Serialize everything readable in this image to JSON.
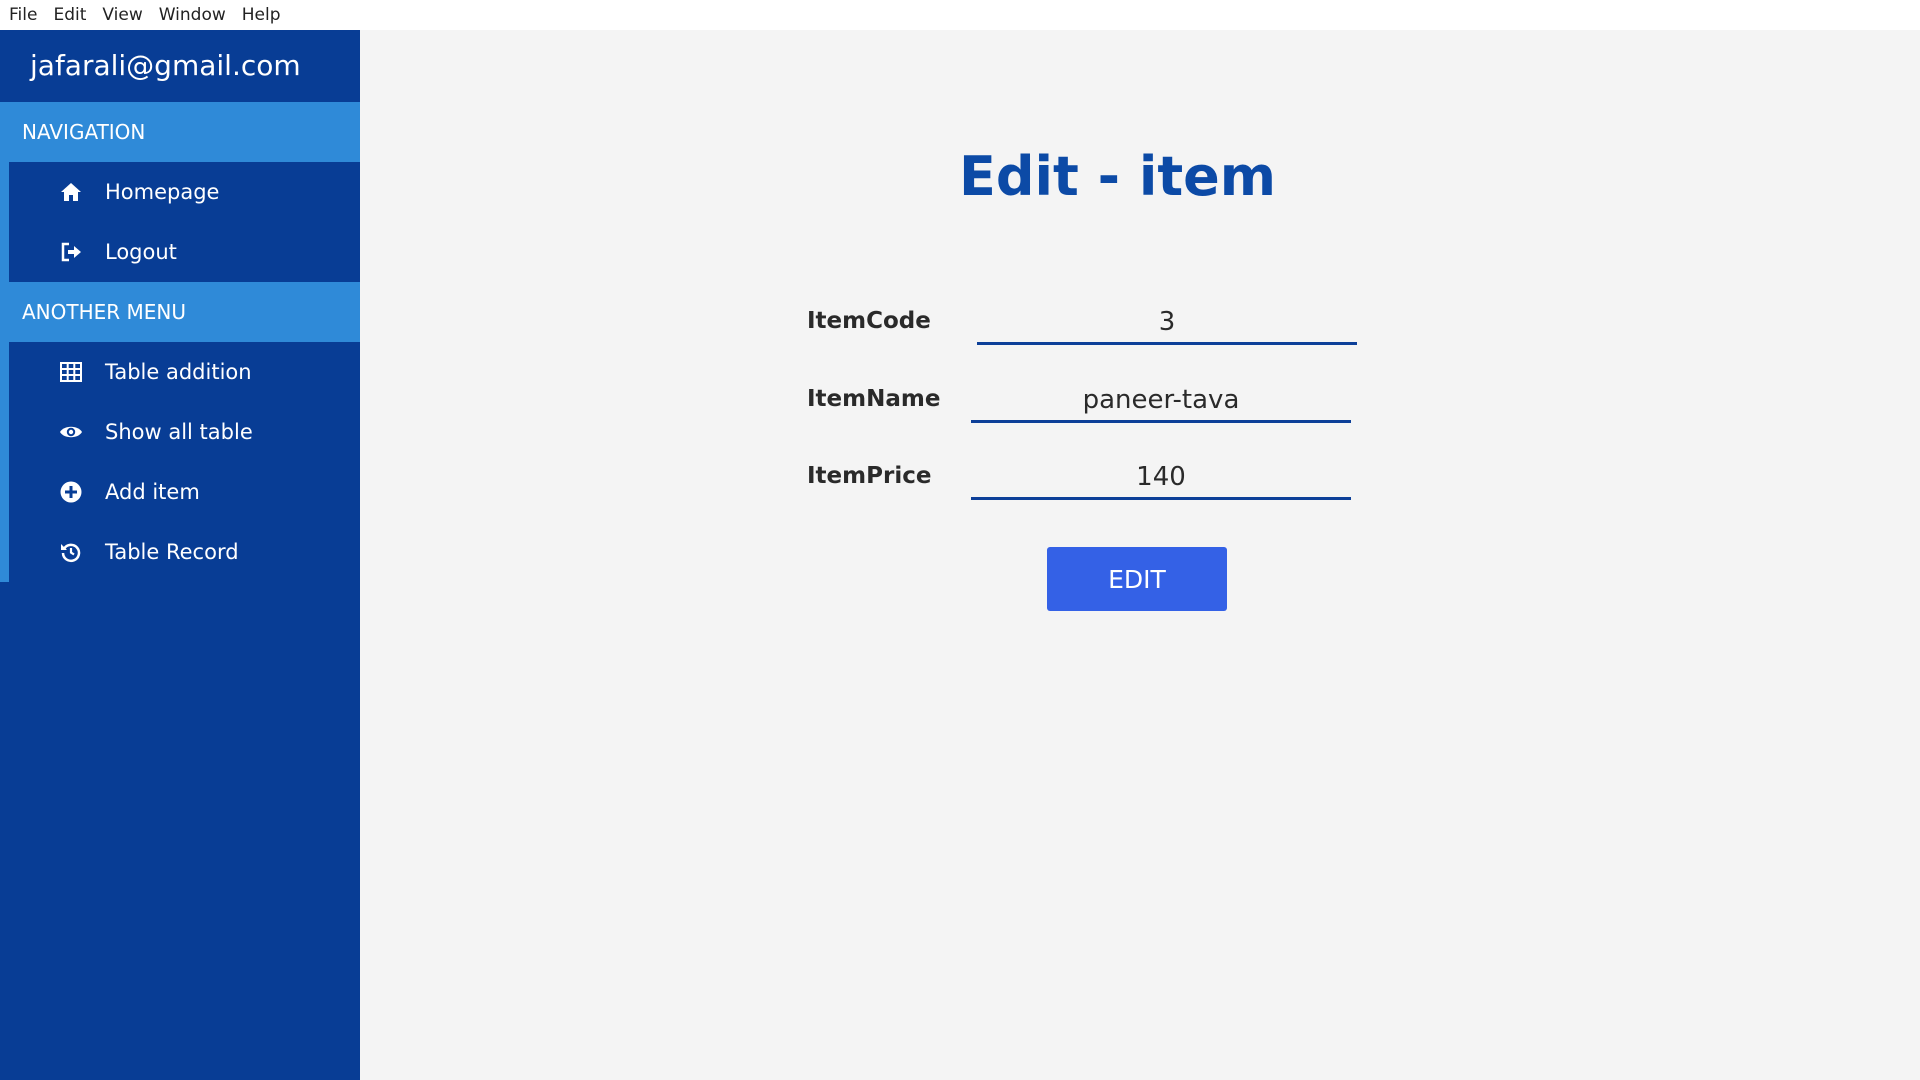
{
  "menubar": {
    "items": [
      "File",
      "Edit",
      "View",
      "Window",
      "Help"
    ]
  },
  "sidebar": {
    "user_email": "jafarali@gmail.com",
    "sections": [
      {
        "title": "NAVIGATION",
        "items": [
          {
            "label": "Homepage",
            "icon": "home-icon"
          },
          {
            "label": "Logout",
            "icon": "logout-icon"
          }
        ]
      },
      {
        "title": "ANOTHER MENU",
        "items": [
          {
            "label": "Table addition",
            "icon": "table-icon"
          },
          {
            "label": "Show all table",
            "icon": "eye-icon"
          },
          {
            "label": "Add item",
            "icon": "plus-circle-icon"
          },
          {
            "label": "Table Record",
            "icon": "history-icon"
          }
        ]
      }
    ]
  },
  "main": {
    "title": "Edit - item",
    "fields": [
      {
        "label": "ItemCode",
        "value": "3"
      },
      {
        "label": "ItemName",
        "value": "paneer-tava"
      },
      {
        "label": "ItemPrice",
        "value": "140"
      }
    ],
    "submit_label": "EDIT"
  },
  "colors": {
    "sidebar_bg": "#083d95",
    "section_header_bg": "#2f8ad8",
    "title": "#0c4aa6",
    "button_bg": "#3461e6",
    "page_bg": "#f4f4f4"
  }
}
